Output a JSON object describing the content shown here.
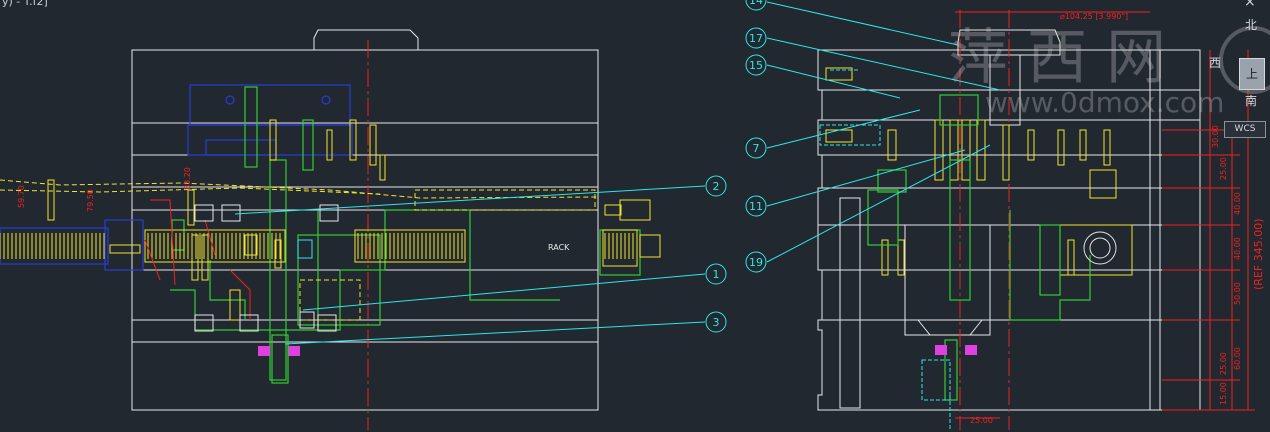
{
  "viewport": {
    "corner_label": "y)  -  T.f2]",
    "close_glyph": "×"
  },
  "left_view": {
    "rack_label": "RACK",
    "callouts": [
      "2",
      "1",
      "3"
    ],
    "side_dims": [
      "59.70",
      "79.50",
      "83.20"
    ]
  },
  "right_view": {
    "callouts": [
      "14",
      "17",
      "15",
      "7",
      "11",
      "19"
    ],
    "top_dim": "⌀104.25  [3.990\"]",
    "bottom_dim": "25.00",
    "right_dims": [
      "30.00",
      "40.00",
      "40.00",
      "50.00",
      "60.00",
      "25.00",
      "25.00",
      "15.00"
    ],
    "ref_dim": "(REF  345.00)"
  },
  "watermark": {
    "cn_text": "萍 西 网",
    "url_text": "www.0dmox.com"
  },
  "viewcube": {
    "north": "北",
    "west": "西",
    "south": "南",
    "face": "上",
    "wcs_label": "WCS"
  },
  "colors": {
    "background": "#212830",
    "outline": "#e8e8e8",
    "yellow": "#f2e531",
    "cyan": "#2ee6e6",
    "green": "#33cc33",
    "red": "#ee2222",
    "blue": "#2a3cd8",
    "magenta": "#e040e0"
  }
}
